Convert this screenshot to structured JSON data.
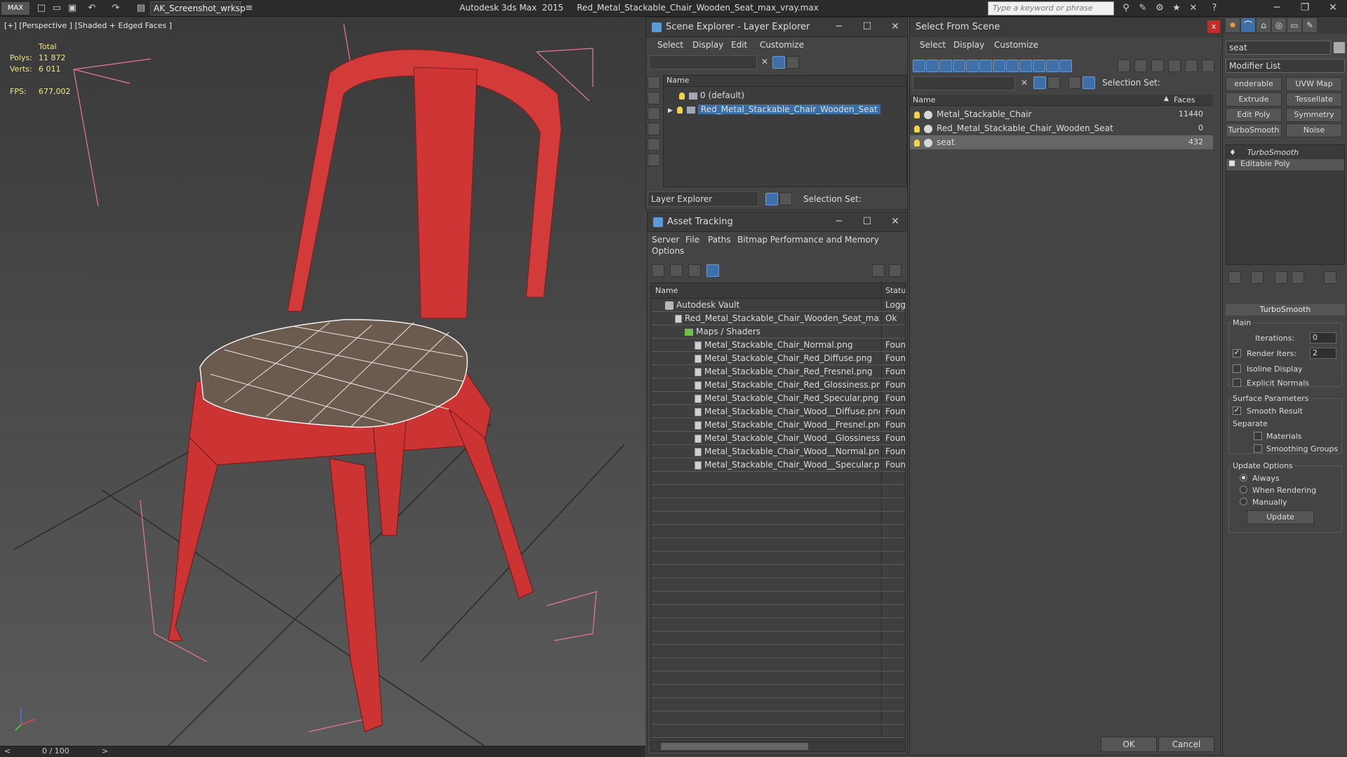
{
  "titlebar": {
    "workspace": "AK_Screenshot_wrksp",
    "app_title": "Autodesk 3ds Max  2015     Red_Metal_Stackable_Chair_Wooden_Seat_max_vray.max",
    "search_placeholder": "Type a keyword or phrase"
  },
  "viewport": {
    "label": "[+] [Perspective ] [Shaded + Edged Faces ]",
    "stats": {
      "total_label": "Total",
      "polys_label": "Polys:",
      "polys_value": "11 872",
      "verts_label": "Verts:",
      "verts_value": "6 011",
      "fps_label": "FPS:",
      "fps_value": "677,002"
    },
    "timeline": "0 / 100"
  },
  "scene_explorer": {
    "title": "Scene Explorer - Layer Explorer",
    "menu": [
      "Select",
      "Display",
      "Edit",
      "Customize"
    ],
    "column_name": "Name",
    "rows": [
      {
        "label": "0 (default)",
        "selected": false
      },
      {
        "label": "Red_Metal_Stackable_Chair_Wooden_Seat",
        "selected": true
      }
    ],
    "explorer_dropdown": "Layer Explorer",
    "selection_set_label": "Selection Set:"
  },
  "asset_tracking": {
    "title": "Asset Tracking",
    "menu": [
      "Server",
      "File",
      "Paths",
      "Bitmap Performance and Memory",
      "Options"
    ],
    "col_name": "Name",
    "col_status": "Status",
    "rows": [
      {
        "name": "Autodesk Vault",
        "status": "Logge",
        "kind": "vault",
        "indent": 0
      },
      {
        "name": "Red_Metal_Stackable_Chair_Wooden_Seat_max_...",
        "status": "Ok",
        "kind": "max",
        "indent": 1
      },
      {
        "name": "Maps / Shaders",
        "status": "",
        "kind": "folder",
        "indent": 2
      },
      {
        "name": "Metal_Stackable_Chair_Normal.png",
        "status": "Found",
        "kind": "file",
        "indent": 3
      },
      {
        "name": "Metal_Stackable_Chair_Red_Diffuse.png",
        "status": "Found",
        "kind": "file",
        "indent": 3
      },
      {
        "name": "Metal_Stackable_Chair_Red_Fresnel.png",
        "status": "Found",
        "kind": "file",
        "indent": 3
      },
      {
        "name": "Metal_Stackable_Chair_Red_Glossiness.png",
        "status": "Found",
        "kind": "file",
        "indent": 3
      },
      {
        "name": "Metal_Stackable_Chair_Red_Specular.png",
        "status": "Found",
        "kind": "file",
        "indent": 3
      },
      {
        "name": "Metal_Stackable_Chair_Wood__Diffuse.png",
        "status": "Found",
        "kind": "file",
        "indent": 3
      },
      {
        "name": "Metal_Stackable_Chair_Wood__Fresnel.png",
        "status": "Found",
        "kind": "file",
        "indent": 3
      },
      {
        "name": "Metal_Stackable_Chair_Wood__Glossiness....",
        "status": "Found",
        "kind": "file",
        "indent": 3
      },
      {
        "name": "Metal_Stackable_Chair_Wood__Normal.png",
        "status": "Found",
        "kind": "file",
        "indent": 3
      },
      {
        "name": "Metal_Stackable_Chair_Wood__Specular.png",
        "status": "Found",
        "kind": "file",
        "indent": 3
      }
    ]
  },
  "select_from_scene": {
    "title": "Select From Scene",
    "menu": [
      "Select",
      "Display",
      "Customize"
    ],
    "selection_set_label": "Selection Set:",
    "col_name": "Name",
    "col_faces": "Faces",
    "rows": [
      {
        "name": "Metal_Stackable_Chair",
        "faces": "11440",
        "selected": false
      },
      {
        "name": "Red_Metal_Stackable_Chair_Wooden_Seat",
        "faces": "0",
        "selected": false
      },
      {
        "name": "seat",
        "faces": "432",
        "selected": true
      }
    ],
    "ok": "OK",
    "cancel": "Cancel"
  },
  "command_panel": {
    "object_name": "seat",
    "modifier_list": "Modifier List",
    "buttons": [
      "enderable Splir",
      "UVW Map",
      "Extrude",
      "Tessellate",
      "Edit Poly",
      "Symmetry",
      "TurboSmooth",
      "Noise"
    ],
    "stack": [
      "TurboSmooth",
      "Editable Poly"
    ],
    "rollout_title": "TurboSmooth",
    "main_label": "Main",
    "iterations_label": "Iterations:",
    "iterations_value": "0",
    "render_iters_label": "Render Iters:",
    "render_iters_value": "2",
    "isoline_label": "Isoline Display",
    "explicit_normals_label": "Explicit Normals",
    "surface_params_label": "Surface Parameters",
    "smooth_result_label": "Smooth Result",
    "separate_label": "Separate",
    "materials_label": "Materials",
    "smoothing_groups_label": "Smoothing Groups",
    "update_options_label": "Update Options",
    "always_label": "Always",
    "when_rendering_label": "When Rendering",
    "manually_label": "Manually",
    "update_button": "Update"
  },
  "colors": {
    "chair_red": "#d33a3a",
    "selection_blue": "#3a6ea5",
    "stat_yellow": "#f0e68c"
  }
}
